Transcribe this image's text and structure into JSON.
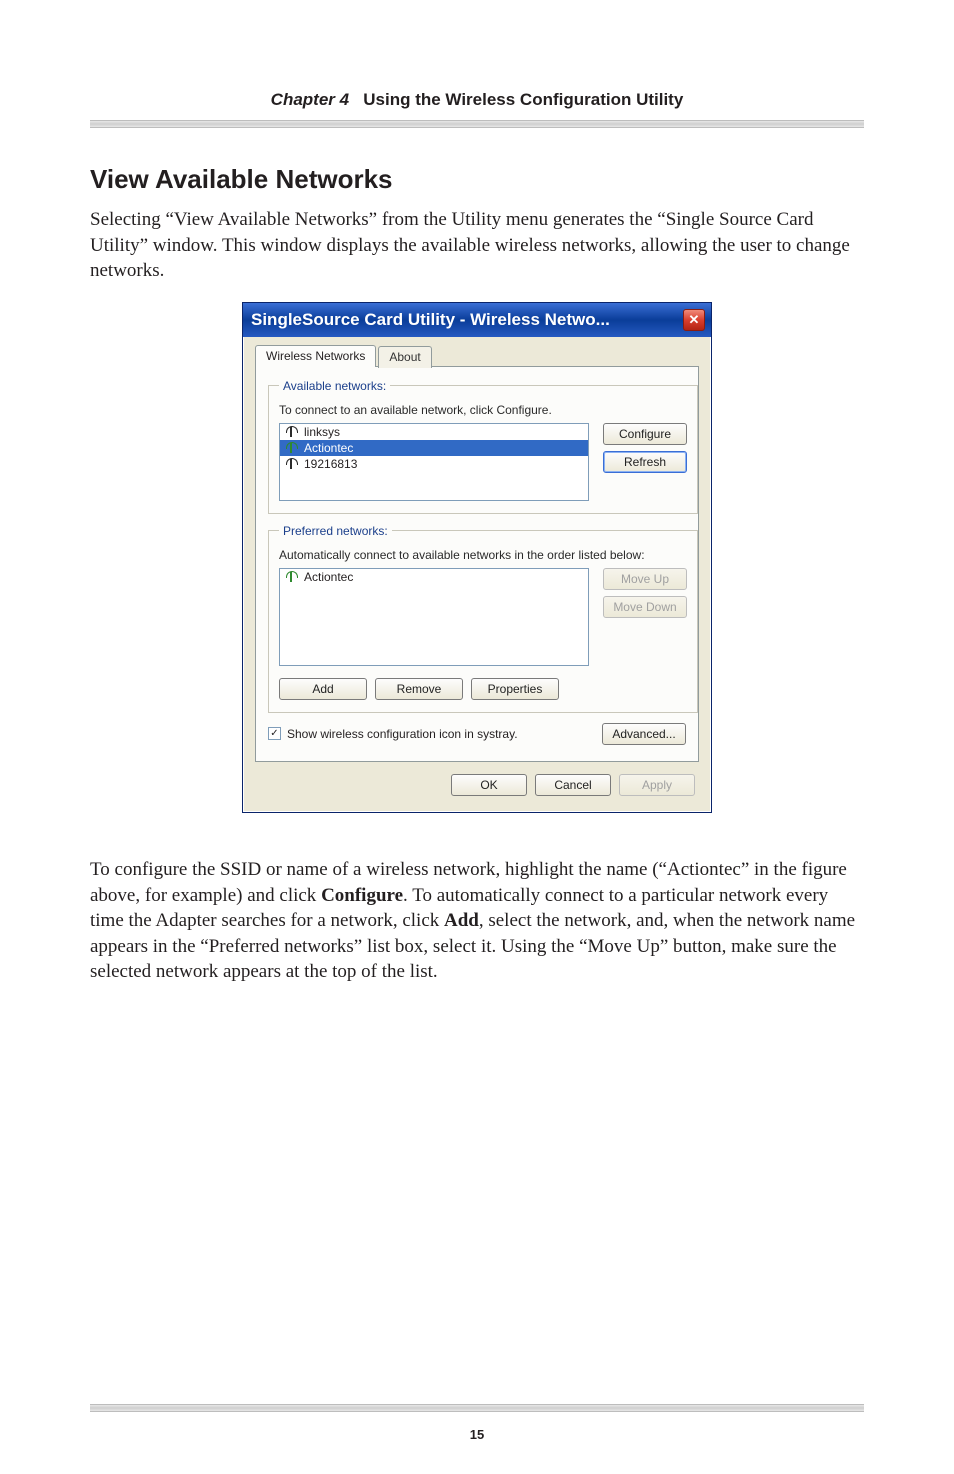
{
  "header": {
    "chapter": "Chapter 4",
    "title": "Using the Wireless Configuration Utility"
  },
  "section": {
    "heading": "View Available Networks",
    "intro": "Selecting “View Available Networks” from the Utility menu generates the “Single Source Card Utility” window. This window displays the available wireless networks, allowing the user to change networks."
  },
  "dialog": {
    "title": "SingleSource Card Utility - Wireless Netwo...",
    "tabs": {
      "active": "Wireless Networks",
      "inactive": "About"
    },
    "available": {
      "legend": "Available networks:",
      "hint": "To connect to an available network, click Configure.",
      "items": [
        "linksys",
        "Actiontec",
        "19216813"
      ],
      "selected_index": 1,
      "configure": "Configure",
      "refresh": "Refresh"
    },
    "preferred": {
      "legend": "Preferred networks:",
      "hint": "Automatically connect to available networks in the order listed below:",
      "items": [
        "Actiontec"
      ],
      "move_up": "Move Up",
      "move_down": "Move Down",
      "add": "Add",
      "remove": "Remove",
      "properties": "Properties"
    },
    "systray": {
      "checkbox_label": "Show wireless configuration icon in systray.",
      "advanced": "Advanced..."
    },
    "footer": {
      "ok": "OK",
      "cancel": "Cancel",
      "apply": "Apply"
    }
  },
  "afterParagraph": "To configure the SSID or name of a wireless network, highlight the name (“Actiontec” in the figure above, for example) and click Configure. To automatically connect to a particular network every time the Adapter searches for a network, click Add, select the network, and, when the network name appears in the “Preferred networks” list box, select it. Using the “Move Up” button, make sure the selected network appears at the top of the list.",
  "pageNumber": "15"
}
